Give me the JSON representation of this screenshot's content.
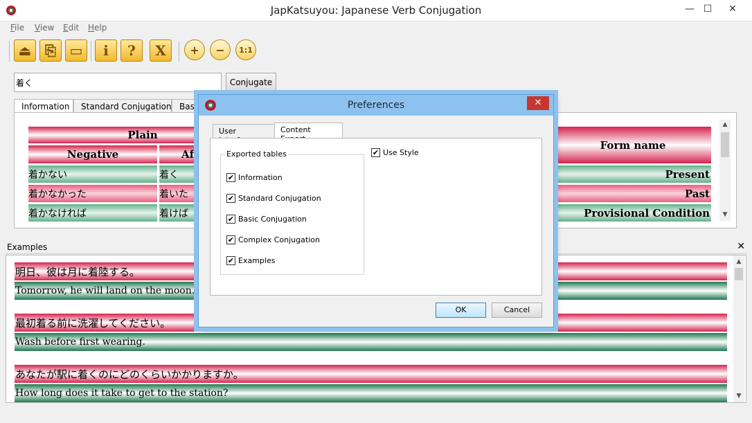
{
  "window": {
    "title": "JapKatsuyou: Japanese Verb Conjugation",
    "min": "—",
    "max": "☐",
    "close": "✕"
  },
  "menu": [
    {
      "key": "F",
      "rest": "ile"
    },
    {
      "key": "V",
      "rest": "iew"
    },
    {
      "key": "E",
      "rest": "dit"
    },
    {
      "key": "H",
      "rest": "elp"
    }
  ],
  "toolbar": {
    "save_icon": "⏏",
    "paste_icon": "⎘",
    "window_icon": "▭",
    "info_icon": "i",
    "help_icon": "?",
    "exit_icon": "X",
    "zoom_in_icon": "+",
    "zoom_out_icon": "−",
    "zoom_reset_icon": "1:1"
  },
  "search": {
    "value": "着く",
    "button": "Conjugate"
  },
  "tabs": [
    "Information",
    "Standard Conjugation",
    "Basic"
  ],
  "table": {
    "plain": "Plain",
    "negative": "Negative",
    "affirmative": "Aff",
    "form_name": "Form name",
    "rows": [
      {
        "neg": "着かない",
        "aff": "着く",
        "form": "Present"
      },
      {
        "neg": "着かなかった",
        "aff": "着いた",
        "form": "Past"
      },
      {
        "neg": "着かなければ",
        "aff": "着けば",
        "form": "Provisional Condition"
      }
    ]
  },
  "examples": {
    "label": "Examples",
    "close": "✕",
    "items": [
      {
        "jp": "明日、彼は月に着陸する。",
        "en": "Tomorrow, he will land on the moon."
      },
      {
        "jp": "最初着る前に洗濯してください。",
        "en": "Wash before first wearing."
      },
      {
        "jp": "あなたが駅に着くのにどのくらいかかりますか。",
        "en": "How long does it take to get to the station?"
      }
    ]
  },
  "dialog": {
    "title": "Preferences",
    "close": "✕",
    "tabs": [
      "User Interface",
      "Content Export"
    ],
    "group_label": "Exported tables",
    "checks": [
      "Information",
      "Standard Conjugation",
      "Basic Conjugation",
      "Complex Conjugation",
      "Examples"
    ],
    "use_style": "Use Style",
    "check_mark": "✔",
    "ok": "OK",
    "cancel": "Cancel"
  },
  "scroll": {
    "up": "▲",
    "down": "▼"
  }
}
